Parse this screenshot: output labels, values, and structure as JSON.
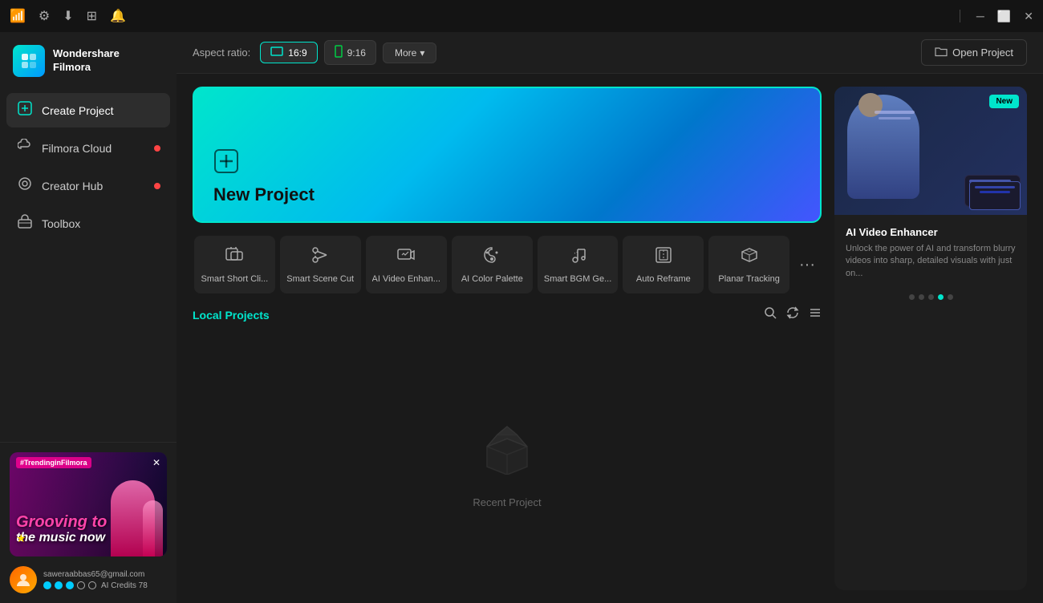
{
  "titleBar": {
    "icons": [
      "wifi-icon",
      "settings-icon",
      "download-icon",
      "apps-icon",
      "bell-icon"
    ],
    "controls": [
      "minimize",
      "maximize",
      "close"
    ]
  },
  "sidebar": {
    "logo": {
      "brandName": "Wondershare",
      "appName": "Filmora"
    },
    "navItems": [
      {
        "id": "create-project",
        "label": "Create Project",
        "icon": "➕",
        "active": true,
        "badge": false
      },
      {
        "id": "filmora-cloud",
        "label": "Filmora Cloud",
        "icon": "☁",
        "active": false,
        "badge": true
      },
      {
        "id": "creator-hub",
        "label": "Creator Hub",
        "icon": "◎",
        "active": false,
        "badge": true
      },
      {
        "id": "toolbox",
        "label": "Toolbox",
        "icon": "🧰",
        "active": false,
        "badge": false
      }
    ],
    "trending": {
      "label": "#TrendinginFilmora",
      "text": "Grooving to the music now"
    },
    "user": {
      "email": "saweraabbas65@gmail.com",
      "creditsLabel": "AI Credits",
      "creditsValue": "78"
    }
  },
  "toolbar": {
    "aspectRatioLabel": "Aspect ratio:",
    "aspectOptions": [
      {
        "label": "16:9",
        "active": true
      },
      {
        "label": "9:16",
        "active": false
      }
    ],
    "moreLabel": "More",
    "openProjectLabel": "Open Project"
  },
  "mainContent": {
    "newProject": {
      "label": "New Project"
    },
    "aiTools": [
      {
        "id": "smart-short-clip",
        "icon": "⬛",
        "label": "Smart Short Cli..."
      },
      {
        "id": "smart-scene-cut",
        "icon": "🎬",
        "label": "Smart Scene Cut"
      },
      {
        "id": "ai-video-enhancer",
        "icon": "✨",
        "label": "AI Video Enhan..."
      },
      {
        "id": "ai-color-palette",
        "icon": "🎨",
        "label": "AI Color Palette"
      },
      {
        "id": "smart-bgm-generate",
        "icon": "🎵",
        "label": "Smart BGM Ge..."
      },
      {
        "id": "auto-reframe",
        "icon": "⬜",
        "label": "Auto Reframe"
      },
      {
        "id": "planar-tracking",
        "icon": "🔲",
        "label": "Planar Tracking"
      }
    ],
    "localProjects": {
      "title": "Local Projects",
      "emptyLabel": "Recent Project"
    }
  },
  "promoPanel": {
    "newBadge": "New",
    "title": "AI Video Enhancer",
    "description": "Unlock the power of AI and transform blurry videos into sharp, detailed visuals with just on...",
    "dots": [
      0,
      1,
      2,
      3,
      4
    ],
    "activeDot": 3
  }
}
